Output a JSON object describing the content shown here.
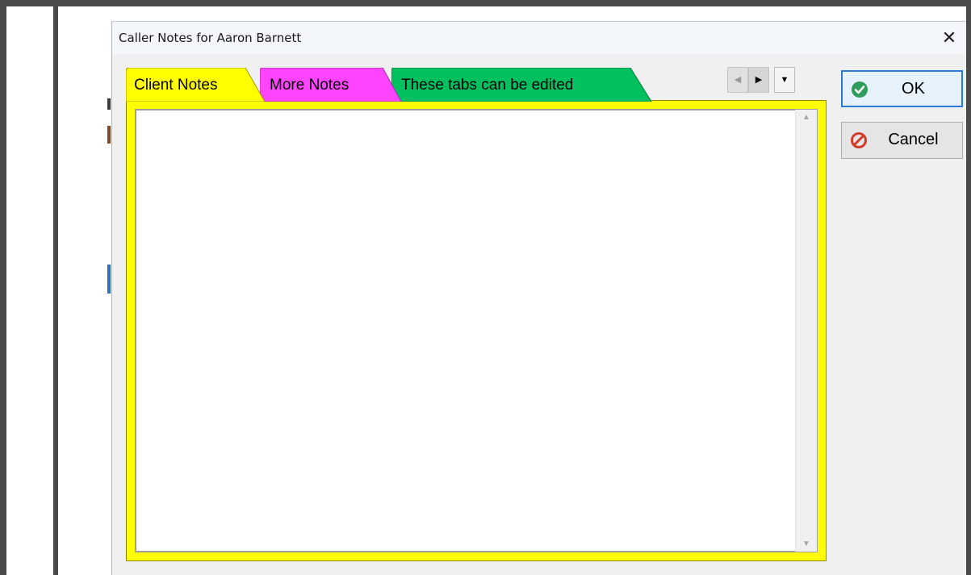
{
  "dialog": {
    "title": "Caller Notes for Aaron Barnett",
    "close_glyph": "✕"
  },
  "tabs": [
    {
      "label": "Client Notes",
      "color": "#ffff00"
    },
    {
      "label": "More Notes",
      "color": "#ff44ff"
    },
    {
      "label": "These tabs can be edited",
      "color": "#00c060"
    }
  ],
  "tab_nav": {
    "prev_glyph": "◀",
    "next_glyph": "▶",
    "menu_glyph": "▼"
  },
  "notes": {
    "value": "",
    "scroll_up_glyph": "▲",
    "scroll_down_glyph": "▼"
  },
  "buttons": {
    "ok_label": "OK",
    "ok_icon": "check-circle-icon",
    "cancel_label": "Cancel",
    "cancel_icon": "no-entry-icon"
  },
  "colors": {
    "active_panel": "#ffff00",
    "ok_focus_border": "#2b7bd6",
    "ok_icon_green": "#2e9d5b",
    "cancel_icon_red": "#d23a2a"
  }
}
